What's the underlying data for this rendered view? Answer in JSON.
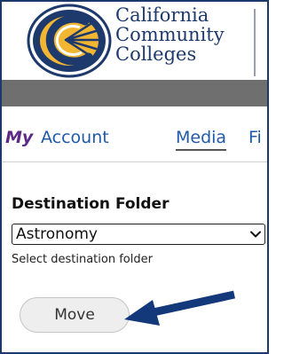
{
  "header": {
    "logo_icon": "california-community-colleges-logo",
    "brand_line1": "California",
    "brand_line2": "Community",
    "brand_line3": "Colleges",
    "brand_color": "#1e3a6d"
  },
  "tabs": [
    {
      "label": "My"
    },
    {
      "label": "Account"
    },
    {
      "label": "Media"
    },
    {
      "label": "Fi"
    }
  ],
  "destination": {
    "label": "Destination Folder",
    "selected": "Astronomy",
    "hint": "Select destination folder"
  },
  "actions": {
    "move_label": "Move"
  },
  "annotation": {
    "arrow_icon": "arrow-left-icon",
    "arrow_color": "#14397a"
  },
  "colors": {
    "frame_border": "#1b3a6b",
    "gray_bar": "#6f6f6f",
    "tab_link": "#1e5aa8",
    "tab_my": "#5c2a86"
  }
}
